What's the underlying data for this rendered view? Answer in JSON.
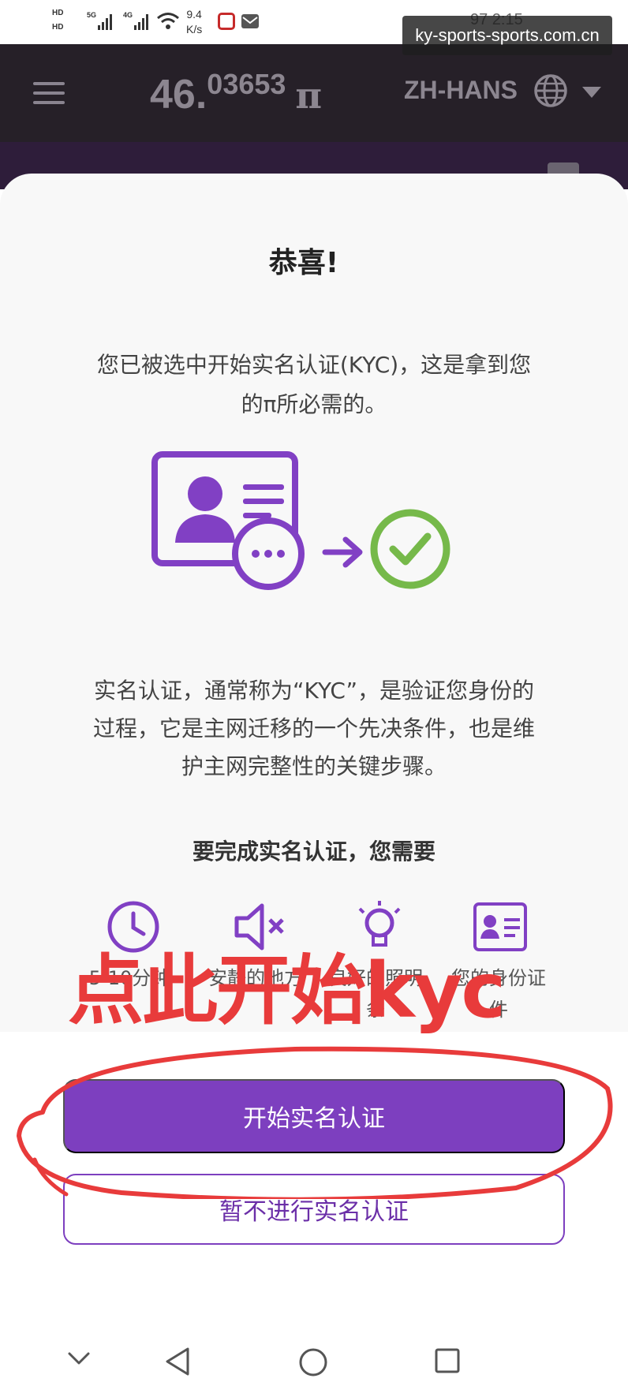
{
  "status_bar": {
    "hd_top": "HD",
    "hd_bottom": "HD",
    "net_a": "5G",
    "net_b": "4G",
    "speed_value": "9.4",
    "speed_unit": "K/s",
    "right_text": "97  2:15"
  },
  "watermark": "ky-sports-sports.com.cn",
  "header": {
    "balance_int": "46.",
    "balance_dec": "03653",
    "balance_unit": "π",
    "language": "ZH-HANS"
  },
  "dialog": {
    "title": "恭喜!",
    "intro": "您已被选中开始实名认证(KYC)，这是拿到您的π所必需的。",
    "description": "实名认证，通常称为“KYC”，是验证您身份的过程，它是主网迁移的一个先决条件，也是维护主网完整性的关键步骤。",
    "requirements_title": "要完成实名认证，您需要",
    "requirements": [
      {
        "icon": "clock-icon",
        "label": "5-10分钟"
      },
      {
        "icon": "quiet-place-icon",
        "label": "安静的地方"
      },
      {
        "icon": "lightbulb-icon",
        "label": "良好的照明条"
      },
      {
        "icon": "id-card-icon",
        "label": "您的身份证件"
      }
    ],
    "overlay_text": "点此开始kyc",
    "primary_button": "开始实名认证",
    "secondary_button": "暂不进行实名认证"
  },
  "colors": {
    "accent": "#7d3fbf",
    "success": "#76b94a",
    "annotation": "#e83b3b",
    "header_bg": "#262028"
  }
}
